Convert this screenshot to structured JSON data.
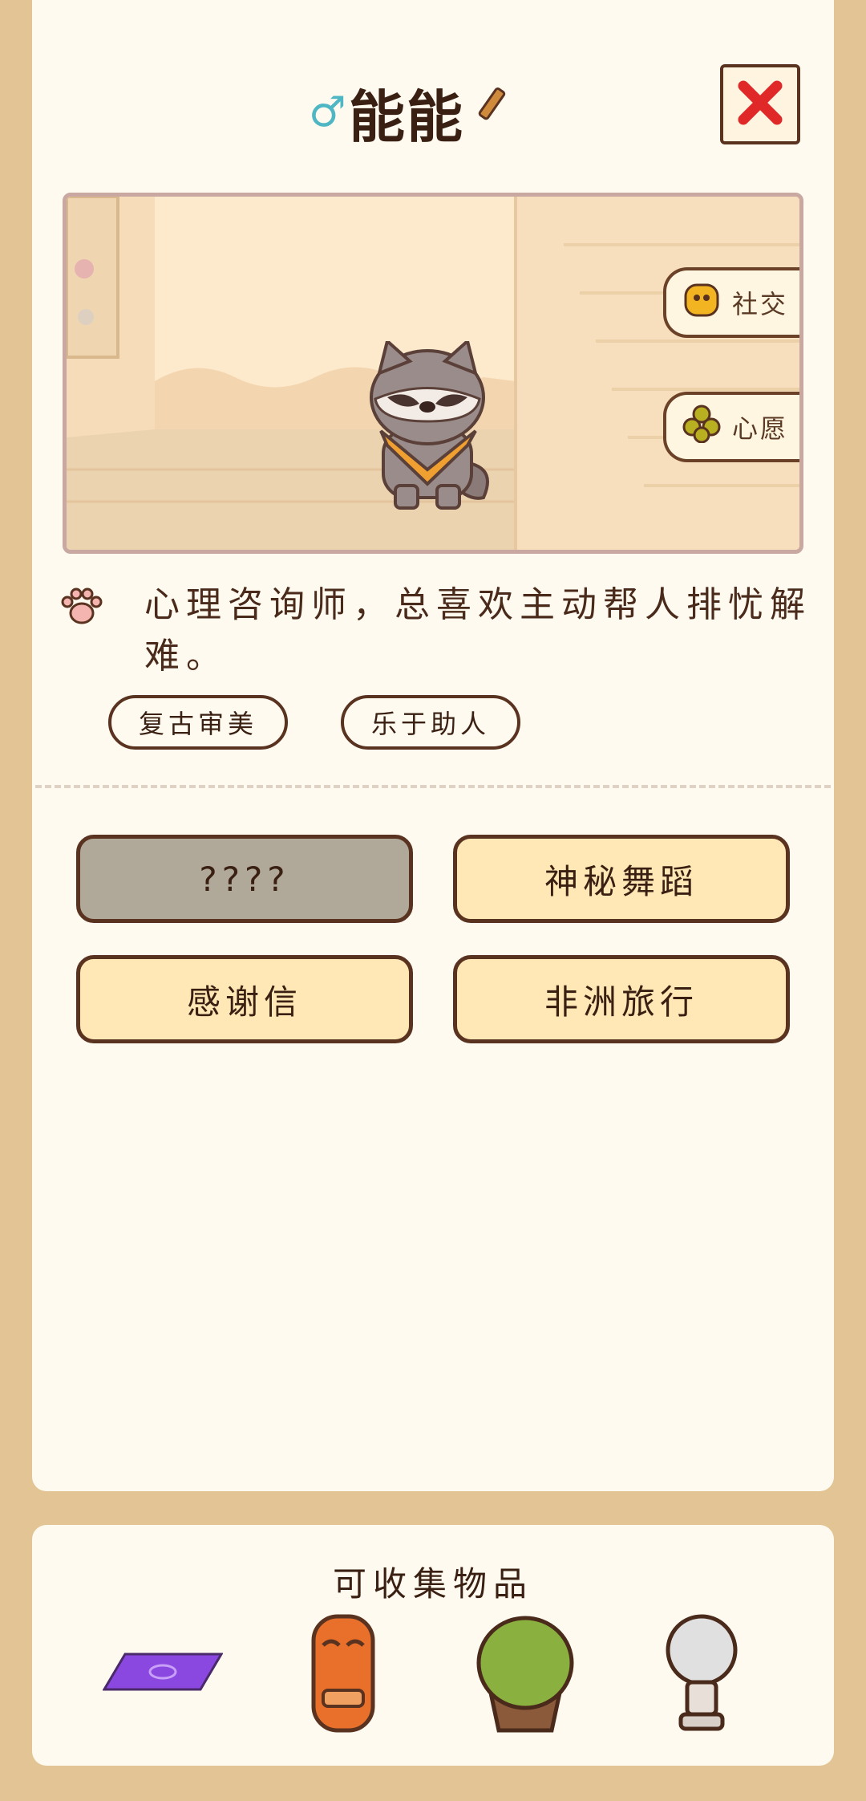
{
  "header": {
    "gender_symbol": "♂",
    "name": "能能",
    "edit_icon": "pencil-icon",
    "close_icon": "close-x-icon"
  },
  "scene": {
    "side_buttons": [
      {
        "label": "社交",
        "icon": "social-icon"
      },
      {
        "label": "心愿",
        "icon": "clover-icon"
      }
    ]
  },
  "profile": {
    "description": "心理咨询师，总喜欢主动帮人排忧解难。",
    "tags": [
      "复古审美",
      "乐于助人"
    ]
  },
  "actions": [
    {
      "label": "????",
      "locked": true
    },
    {
      "label": "神秘舞蹈",
      "locked": false
    },
    {
      "label": "感谢信",
      "locked": false
    },
    {
      "label": "非洲旅行",
      "locked": false
    }
  ],
  "collectibles": {
    "title": "可收集物品",
    "items": [
      "carpet-icon",
      "tiki-mask-icon",
      "cactus-pot-icon",
      "lightbulb-icon"
    ]
  },
  "colors": {
    "page_bg": "#e3c595",
    "card_bg": "#fffaf0",
    "button_bg": "#ffe8b6",
    "locked_bg": "#b0a898",
    "close_red": "#e02828",
    "gender_blue": "#4fb6c4"
  }
}
